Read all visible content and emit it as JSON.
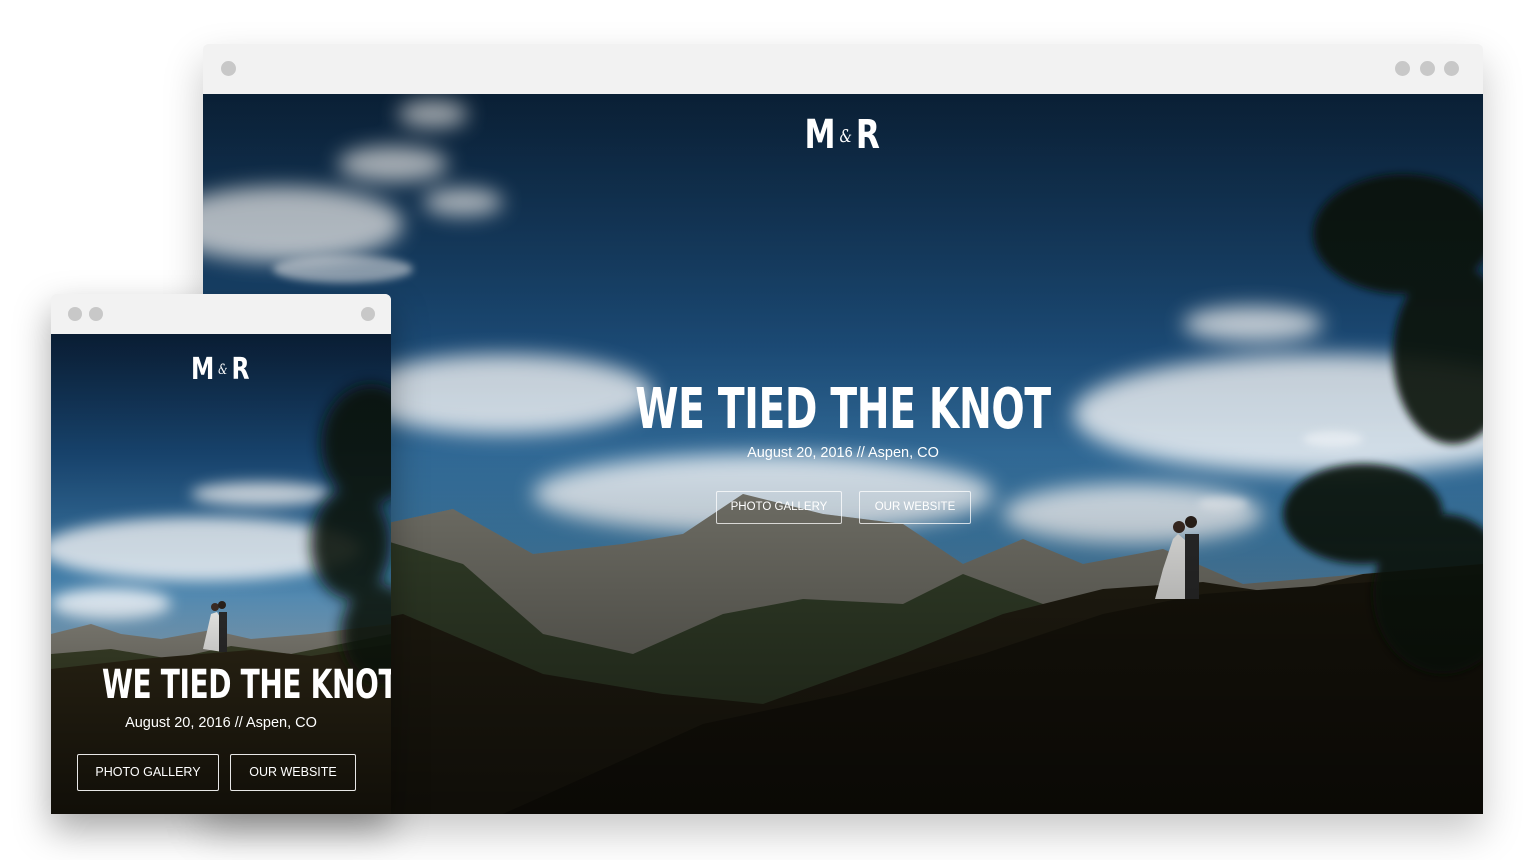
{
  "desktop": {
    "logo": {
      "left": "M",
      "amp": "&",
      "right": "R"
    },
    "headline": "WE TIED THE KNOT",
    "subline": "August 20, 2016 // Aspen, CO",
    "buttons": {
      "gallery": "PHOTO GALLERY",
      "website": "OUR WEBSITE"
    }
  },
  "mobile": {
    "logo": {
      "left": "M",
      "amp": "&",
      "right": "R"
    },
    "headline": "WE TIED THE KNOT",
    "subline": "August 20, 2016 // Aspen, CO",
    "buttons": {
      "gallery": "PHOTO GALLERY",
      "website": "OUR WEBSITE"
    }
  },
  "colors": {
    "chrome": "#f2f2f2",
    "chrome_dot": "#c8c8c8",
    "sky_top": "#0e2c4a",
    "sky_mid": "#2f6e9e",
    "mountain_dark": "#1c1a10",
    "text": "#ffffff"
  },
  "icons": {
    "desktop_chrome_dots": [
      "window-dot-icon",
      "window-dot-icon",
      "window-dot-icon",
      "window-dot-icon"
    ],
    "mobile_chrome_dots": [
      "window-dot-icon",
      "window-dot-icon",
      "window-dot-icon"
    ]
  }
}
